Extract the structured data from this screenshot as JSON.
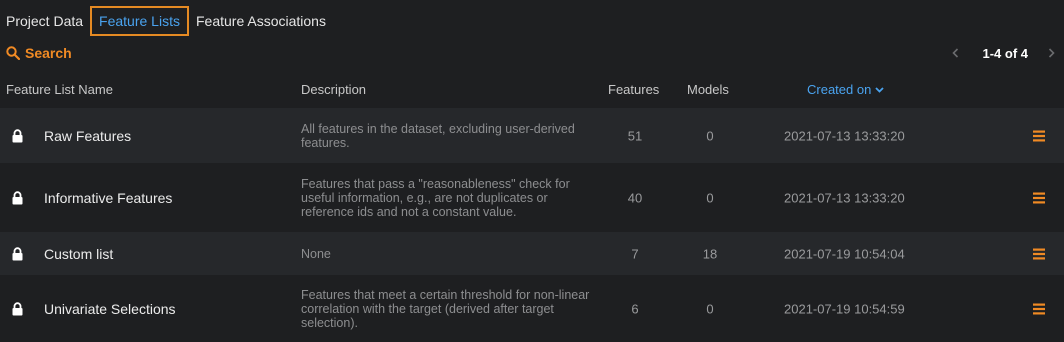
{
  "tabs": [
    "Project Data",
    "Feature Lists",
    "Feature Associations"
  ],
  "active_tab": "Feature Lists",
  "search_label": "Search",
  "pagination": "1-4 of 4",
  "columns": {
    "name": "Feature List Name",
    "description": "Description",
    "features": "Features",
    "models": "Models",
    "created": "Created on"
  },
  "rows": [
    {
      "name": "Raw Features",
      "description": "All features in the dataset, excluding user-derived features.",
      "features": "51",
      "models": "0",
      "created": "2021-07-13 13:33:20"
    },
    {
      "name": "Informative Features",
      "description": "Features that pass a \"reasonableness\" check for useful information, e.g., are not duplicates or reference ids and not a constant value.",
      "features": "40",
      "models": "0",
      "created": "2021-07-13 13:33:20"
    },
    {
      "name": "Custom list",
      "description": "None",
      "features": "7",
      "models": "18",
      "created": "2021-07-19 10:54:04"
    },
    {
      "name": "Univariate Selections",
      "description": "Features that meet a certain threshold for non-linear correlation with the target (derived after target selection).",
      "features": "6",
      "models": "0",
      "created": "2021-07-19 10:54:59"
    }
  ],
  "colors": {
    "accent_orange": "#f08a24",
    "link_blue": "#4aa3ef",
    "background": "#1e1f21"
  },
  "icons": [
    "search-icon",
    "chevron-left-icon",
    "chevron-right-icon",
    "chevron-down-icon",
    "lock-icon",
    "menu-icon"
  ]
}
